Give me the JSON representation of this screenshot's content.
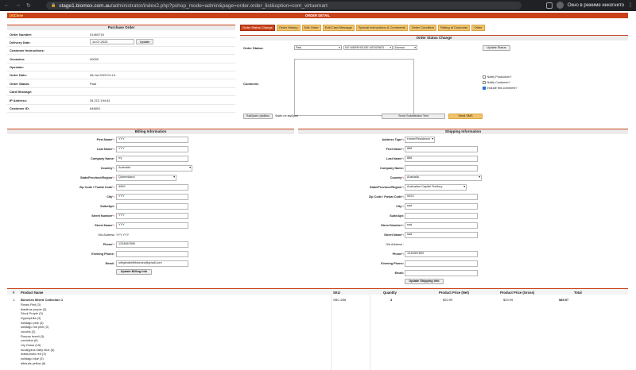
{
  "browser": {
    "url_host": "stage1.biomex.com.au",
    "url_path": "/administrator/index2.php?pshop_mode=admin&page=order.order_list&option=com_virtuemart",
    "incognito_label": "Окно в режиме инкогнито"
  },
  "header": {
    "close_label": "[X]Close",
    "title": "ORDER DETAIL"
  },
  "purchase_order": {
    "title": "Purchase Order",
    "order_number_label": "Order Number:",
    "order_number": "01460715",
    "delivery_date_label": "Delivery Date:",
    "delivery_date": "14-07-2023",
    "update_label": "Update",
    "customer_instructions_label": "Customer Instructions:",
    "occasion_label": "Occasion:",
    "occasion": "00000",
    "operator_label": "Operator:",
    "order_date_label": "Order Date:",
    "order_date": "08-Jul-2023 01:14",
    "order_status_label": "Order Status:",
    "order_status": "Paid",
    "card_message_label": "Card Message:",
    "ip_label": "IP Address:",
    "ip": "34.212.194.81",
    "customer_id_label": "Customer ID:",
    "customer_id": "646801"
  },
  "tabs": [
    "Order Status Change",
    "Order History",
    "Edit Order",
    "Edit Card Message",
    "Special Instructions & Comments",
    "Order Condition",
    "Rating of Customer",
    "Other"
  ],
  "status_change": {
    "title": "Order Status Change",
    "status_label": "Order Status:",
    "status_value": "Paid",
    "warehouse_value": "NO WAREHOUSE ASSIGNED",
    "priority_value": "Normal",
    "update_status_label": "Update Status",
    "comment_label": "Comment:",
    "notify_production": "Notify Production?",
    "notify_customer": "Notify Customer?",
    "include_comment": "Include this comment?",
    "choose_file": "Выбрать файлы",
    "no_file": "Файл не выбран",
    "send_substitution": "Send Substitution Text",
    "send_sms": "Send SMS"
  },
  "billing": {
    "title": "Billing Information",
    "first_name_label": "First Name",
    "first_name": "YYY",
    "last_name_label": "Last Name",
    "last_name": "YYY",
    "company_label": "Company Name:",
    "company": "rry",
    "country_label": "Country",
    "country": "Australia",
    "state_label": "State/Province/Region",
    "state": "Queensland",
    "zip_label": "Zip Code / Postal Code",
    "zip": "9999",
    "city_label": "City",
    "city": "YYY",
    "suite_label": "Suite/Apt:",
    "suite": "",
    "street_number_label": "Street Number",
    "street_number": "YYY",
    "street_name_label": "Street Name",
    "street_name": "YYY",
    "old_address_label": "Old Address",
    "old_address": "YYY YYY",
    "phone_label": "Phone",
    "phone": "1234567890",
    "evening_phone_label": "Evening Phone:",
    "evening_phone": "",
    "email_label": "Email:",
    "email": "orttgtmdeefbbiomex@gmail.com",
    "update_label": "Update Billing Info"
  },
  "shipping": {
    "title": "Shipping Information",
    "address_type_label": "Address Type",
    "address_type": "Home/Residence",
    "first_name_label": "First Name",
    "first_name": "888",
    "last_name_label": "Last Name",
    "last_name": "888",
    "company_label": "Company Name:",
    "company": "",
    "country_label": "Country",
    "country": "Australia",
    "state_label": "State/Province/Region",
    "state": "Australian Capital Territory",
    "zip_label": "Zip Code / Postal Code",
    "zip": "0023",
    "city_label": "City",
    "city": "sad",
    "suite_label": "Suite/Apt:",
    "suite": "",
    "street_number_label": "Street Number",
    "street_number": "sad",
    "street_name_label": "Street Name",
    "street_name": "sad",
    "old_address_label": "Old Address :",
    "old_address": "",
    "phone_label": "Phone",
    "phone": "1234567890",
    "evening_phone_label": "Evening Phone:",
    "evening_phone": "",
    "email_label": "Email:",
    "email": "",
    "update_label": "Update Shipping Info"
  },
  "products": {
    "headers": {
      "num": "#",
      "name": "Product Name",
      "sku": "SKU",
      "qty": "Quantity",
      "net": "Product Price (Net)",
      "gross": "Product Price (Gross)",
      "total": "Total"
    },
    "row": {
      "num": "1.",
      "name": "Bunches Mixed Collection 1",
      "sku": "SBC-656",
      "qty": "3",
      "net": "$20.99",
      "gross": "$29.99",
      "total": "$89.97",
      "items": [
        "Roses Red (3)",
        "dianthus purple (3)",
        "Stock Purple (3)",
        "Gypsophila (3)",
        "solidago pink (3)",
        "solidago hot pink (3)",
        "cocuba (2)",
        "Ruscus breeli (3)",
        "cordoline (6)",
        "Lily Grass (15)",
        "eucalyptus baby blue (6)",
        "matsumoto red (3)",
        "solidago blue (3)",
        "dibbuds yellow (6)"
      ]
    }
  }
}
